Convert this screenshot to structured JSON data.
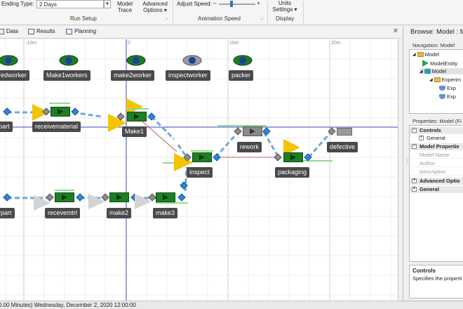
{
  "ribbon": {
    "ending_type_label": "Ending Type:",
    "ending_type_value": "2 Days",
    "model_trace": [
      "Model",
      "Trace"
    ],
    "advanced_options": [
      "Advanced",
      "Options ▾"
    ],
    "run_setup_label": "Run Setup",
    "adjust_speed_label": "Adjust Speed:",
    "speed_minus": "–",
    "speed_plus": "+",
    "speed_fraction": 0.35,
    "animation_speed_label": "Animation Speed",
    "units_settings": [
      "Units",
      "Settings ▾"
    ],
    "display_label": "Display"
  },
  "view_tabs": [
    {
      "label": "Data",
      "icon": "table-icon"
    },
    {
      "label": "Results",
      "icon": "results-icon"
    },
    {
      "label": "Planning",
      "icon": "planning-icon"
    }
  ],
  "canvas": {
    "ruler_labels": [
      "-10m",
      "0",
      "10m",
      "20m"
    ],
    "workers": [
      "redworker",
      "Make1workers",
      "make2worker",
      "inspectworker",
      "packer"
    ],
    "objects": [
      "part",
      "receivematerial",
      "Make1",
      "inspect",
      "rework",
      "packaging",
      "defective",
      "rpart",
      "recevemtrl",
      "make2",
      "make3"
    ]
  },
  "right_panel": {
    "browse_title": "Browse: Model : M",
    "nav_title": "Navigation: Model",
    "tree": [
      "Model",
      "ModelEntity",
      "Model",
      "Experim",
      "Exp",
      "Exp"
    ],
    "properties_title": "Properties: Model (Fi",
    "properties": {
      "controls": "Controls",
      "general_sub": "General",
      "model_properties": "Model Propertie",
      "model_name": "Model Name",
      "author": "Author",
      "description": "Description",
      "advanced_options": "Advanced Optio",
      "general": "General"
    },
    "help_title": "Controls",
    "help_text": "Specifies the properti"
  },
  "status": {
    "text": "0.00 Minutes) Wednesday, December 2, 2020 12:00:00"
  },
  "colors": {
    "server_green": "#1d7f24",
    "entity_yellow": "#f3c400",
    "node_blue": "#2d86e0",
    "axis_blue": "#4040c8",
    "connector_blue": "#6fa8dc"
  }
}
